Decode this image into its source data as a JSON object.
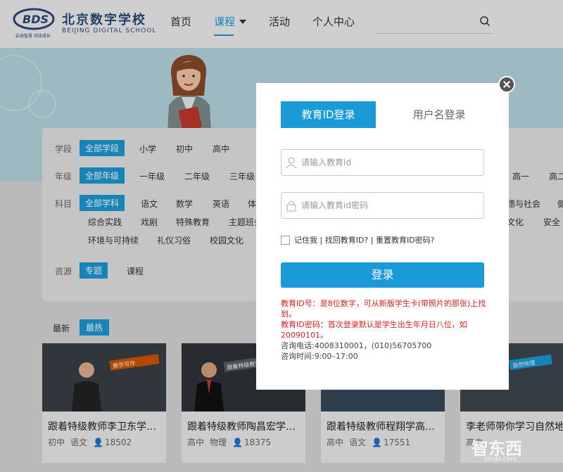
{
  "header": {
    "logo_mark": "BDS",
    "logo_cn": "北京数字学校",
    "logo_en": "BEIJING DIGITAL SCHOOL",
    "logo_sub": "启迪智慧 润泽成长",
    "nav": [
      "首页",
      "课程",
      "活动",
      "个人中心"
    ],
    "active_nav": "课程"
  },
  "filter": {
    "stage_label": "学段",
    "stage_options": [
      "全部学段",
      "小学",
      "初中",
      "高中"
    ],
    "grade_label": "年级",
    "grade_options": [
      "全部年级",
      "一年级",
      "二年级",
      "三年级",
      "高一",
      "高二"
    ],
    "subject_label": "科目",
    "subject_options": [
      "全部学科",
      "语文",
      "数学",
      "英语",
      "体",
      "德与社会",
      "健"
    ],
    "subject_row2": [
      "综合实践",
      "戏剧",
      "特殊教育",
      "主题班会",
      "文化",
      "安全"
    ],
    "subject_row3": [
      "环境与可持续",
      "礼仪习俗",
      "校园文化"
    ],
    "resource_label": "资源",
    "resource_options": [
      "专题",
      "课程"
    ]
  },
  "sort": [
    "最新",
    "最热"
  ],
  "cards": [
    {
      "title": "跟着特级教师李卫东学…",
      "stage": "初中",
      "subject": "语文",
      "views": "18502",
      "tag": "教学写作"
    },
    {
      "title": "跟着特级教师陶昌宏学…",
      "stage": "高中",
      "subject": "物理",
      "views": "18375",
      "tag": "跟着特级教师学"
    },
    {
      "title": "跟着特级教师程翔学高…",
      "stage": "高中",
      "subject": "语文",
      "views": "17551",
      "tag": ""
    },
    {
      "title": "李老师带你学习自然地…",
      "stage": "高中",
      "subject": "",
      "views": "",
      "tag": "自然地理"
    }
  ],
  "modal": {
    "tab_edu": "教育ID登录",
    "tab_user": "用户名登录",
    "edu_id_placeholder": "请输入教育id",
    "password_placeholder": "请输入教育id密码",
    "remember": "记住我 | 找回教育ID? | 重置教育ID密码?",
    "login": "登录",
    "note1": "教育ID号：是8位数字，可从新版学生卡(带照片的那张)上找到。",
    "note2": "教育ID密码：首次登录默认是学生出生年月日八位，如20090101。",
    "phone": "咨询电话:4008310001，(010)56705700",
    "hours": "咨询时间:9:00–17:00"
  },
  "watermark": "智东西",
  "watermark_sub": "zhidx.com",
  "colors": {
    "accent": "#1a9ad6",
    "warning": "#e02020",
    "logo": "#2b4b78"
  }
}
